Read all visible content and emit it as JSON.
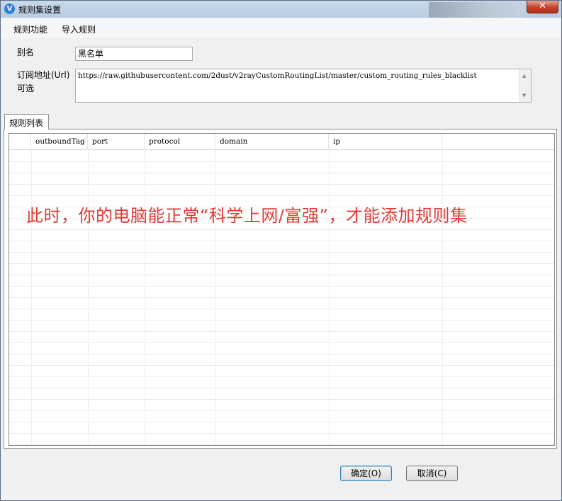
{
  "window": {
    "title": "规则集设置",
    "close_label": "✕"
  },
  "menu": {
    "items": [
      "规则功能",
      "导入规则"
    ]
  },
  "form": {
    "alias_label": "别名",
    "alias_value": "黑名单",
    "url_label_line1": "订阅地址(Url)",
    "url_label_line2": "可选",
    "url_value": "https://raw.githubusercontent.com/2dust/v2rayCustomRoutingList/master/custom_routing_rules_blacklist"
  },
  "tab": {
    "label": "规则列表"
  },
  "grid": {
    "columns": [
      "outboundTag",
      "port",
      "protocol",
      "domain",
      "ip"
    ]
  },
  "overlay": {
    "text": "此时，你的电脑能正常“科学上网/富强”，才能添加规则集",
    "color": "#e53935"
  },
  "buttons": {
    "ok": "确定(O)",
    "cancel": "取消(C)"
  }
}
